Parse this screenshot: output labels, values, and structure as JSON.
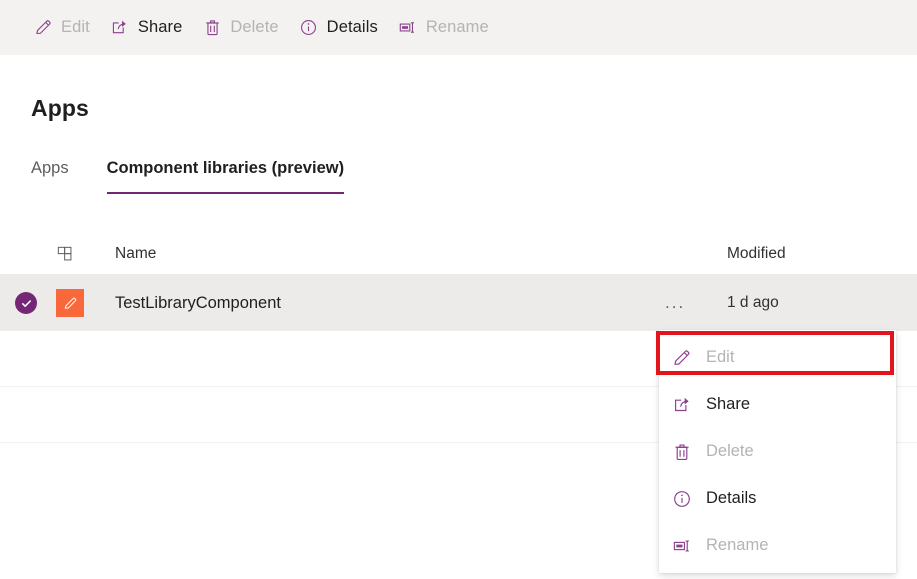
{
  "colors": {
    "accent_purple": "#742774",
    "icon_purple": "#8c3f8c",
    "app_tile_orange": "#f9683a",
    "commandbar_bg": "#f3f2f1",
    "selected_row_bg": "#edebe9",
    "annotation_red": "#e3141b",
    "disabled_text": "#b6b3b1",
    "primary_text": "#201f1e"
  },
  "commandbar": {
    "items": [
      {
        "label": "Edit",
        "icon": "pencil-icon",
        "enabled": false
      },
      {
        "label": "Share",
        "icon": "share-icon",
        "enabled": true
      },
      {
        "label": "Delete",
        "icon": "trash-icon",
        "enabled": false
      },
      {
        "label": "Details",
        "icon": "info-icon",
        "enabled": true
      },
      {
        "label": "Rename",
        "icon": "rename-icon",
        "enabled": false
      }
    ]
  },
  "page": {
    "title": "Apps"
  },
  "tabs": [
    {
      "label": "Apps",
      "active": false
    },
    {
      "label": "Component libraries (preview)",
      "active": true
    }
  ],
  "table": {
    "columns": {
      "grid_icon": "grid-icon",
      "name": "Name",
      "modified": "Modified"
    },
    "rows": [
      {
        "selected": true,
        "check_icon": "checkmark-icon",
        "app_icon": "pencil-app-icon",
        "name": "TestLibraryComponent",
        "more": "...",
        "modified": "1 d ago"
      }
    ]
  },
  "context_menu": {
    "items": [
      {
        "label": "Edit",
        "icon": "pencil-icon",
        "enabled": false,
        "highlighted": true
      },
      {
        "label": "Share",
        "icon": "share-icon",
        "enabled": true,
        "highlighted": false
      },
      {
        "label": "Delete",
        "icon": "trash-icon",
        "enabled": false,
        "highlighted": false
      },
      {
        "label": "Details",
        "icon": "info-icon",
        "enabled": true,
        "highlighted": false
      },
      {
        "label": "Rename",
        "icon": "rename-icon",
        "enabled": false,
        "highlighted": false
      }
    ]
  }
}
